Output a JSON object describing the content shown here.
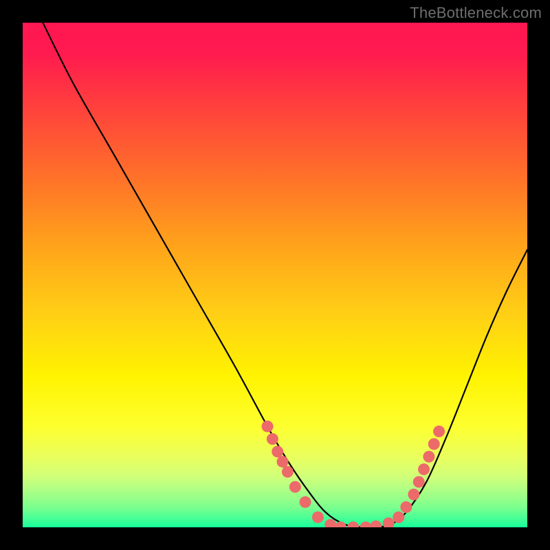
{
  "watermark": "TheBottleneck.com",
  "colors": {
    "page_bg": "#000000",
    "curve_stroke": "#000000",
    "dot_fill": "#ec6a6a",
    "watermark": "#6e6e6e"
  },
  "chart_data": {
    "type": "line",
    "title": "",
    "xlabel": "",
    "ylabel": "",
    "xlim": [
      0,
      100
    ],
    "ylim": [
      0,
      100
    ],
    "series": [
      {
        "name": "bottleneck-curve",
        "x": [
          4,
          10,
          18,
          26,
          34,
          42,
          48.5,
          52,
          56,
          60,
          64,
          68,
          70,
          73,
          76,
          80,
          84,
          88,
          92,
          96,
          100
        ],
        "values": [
          100,
          88,
          74,
          60,
          46,
          32,
          20,
          14,
          8,
          3,
          0.5,
          0,
          0,
          0.6,
          3,
          9,
          18,
          28,
          38,
          47,
          55
        ]
      }
    ],
    "dots": [
      {
        "x": 48.5,
        "y": 20.0
      },
      {
        "x": 49.5,
        "y": 17.5
      },
      {
        "x": 50.5,
        "y": 15.0
      },
      {
        "x": 51.5,
        "y": 13.0
      },
      {
        "x": 52.5,
        "y": 11.0
      },
      {
        "x": 54.0,
        "y": 8.0
      },
      {
        "x": 56.0,
        "y": 5.0
      },
      {
        "x": 58.5,
        "y": 2.0
      },
      {
        "x": 61.0,
        "y": 0.5
      },
      {
        "x": 63.0,
        "y": 0.0
      },
      {
        "x": 65.5,
        "y": 0.0
      },
      {
        "x": 68.0,
        "y": 0.0
      },
      {
        "x": 70.0,
        "y": 0.2
      },
      {
        "x": 72.5,
        "y": 0.8
      },
      {
        "x": 74.5,
        "y": 2.0
      },
      {
        "x": 76.0,
        "y": 4.0
      },
      {
        "x": 77.5,
        "y": 6.5
      },
      {
        "x": 78.5,
        "y": 9.0
      },
      {
        "x": 79.5,
        "y": 11.5
      },
      {
        "x": 80.5,
        "y": 14.0
      },
      {
        "x": 81.5,
        "y": 16.5
      },
      {
        "x": 82.5,
        "y": 19.0
      }
    ],
    "gradient_stops": [
      {
        "pos": 0.0,
        "color": "#ff1751"
      },
      {
        "pos": 0.3,
        "color": "#ff6f2a"
      },
      {
        "pos": 0.58,
        "color": "#ffd015"
      },
      {
        "pos": 0.8,
        "color": "#fdff2e"
      },
      {
        "pos": 1.0,
        "color": "#17ff9b"
      }
    ]
  }
}
